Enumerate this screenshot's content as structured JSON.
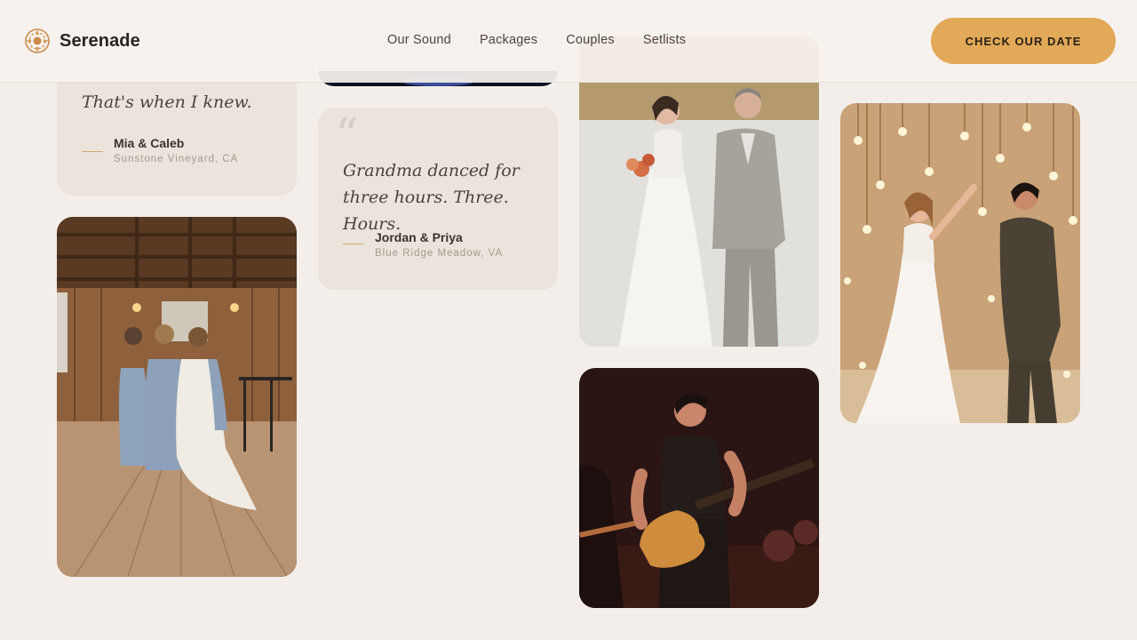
{
  "brand": {
    "name": "Serenade",
    "logo_icon": "sunflower-logo-icon",
    "accent_color": "#e2a959"
  },
  "nav": {
    "items": [
      "Our Sound",
      "Packages",
      "Couples",
      "Setlists"
    ]
  },
  "cta": {
    "label": "CHECK OUR DATE"
  },
  "testimonials": [
    {
      "quote": "That's when I knew.",
      "name": "Mia & Caleb",
      "place": "Sunstone Vineyard, CA"
    },
    {
      "quote": "Grandma danced for three hours. Three. Hours.",
      "name": "Jordan & Priya",
      "place": "Blue Ridge Meadow, VA"
    }
  ],
  "photos": [
    {
      "subject": "bridesmaids-barn-photo"
    },
    {
      "subject": "bride-and-father-photo"
    },
    {
      "subject": "guitarist-photo"
    },
    {
      "subject": "first-dance-photo"
    }
  ]
}
